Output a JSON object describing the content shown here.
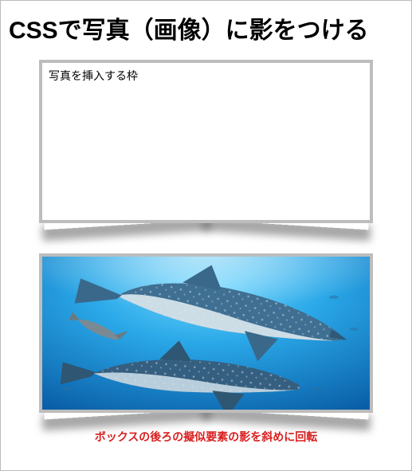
{
  "title": "CSSで写真（画像）に影をつける",
  "frame_label": "写真を挿入する枠",
  "caption": "ボックスの後ろの擬似要素の影を斜めに回転",
  "image_alt": "underwater-whale-sharks"
}
